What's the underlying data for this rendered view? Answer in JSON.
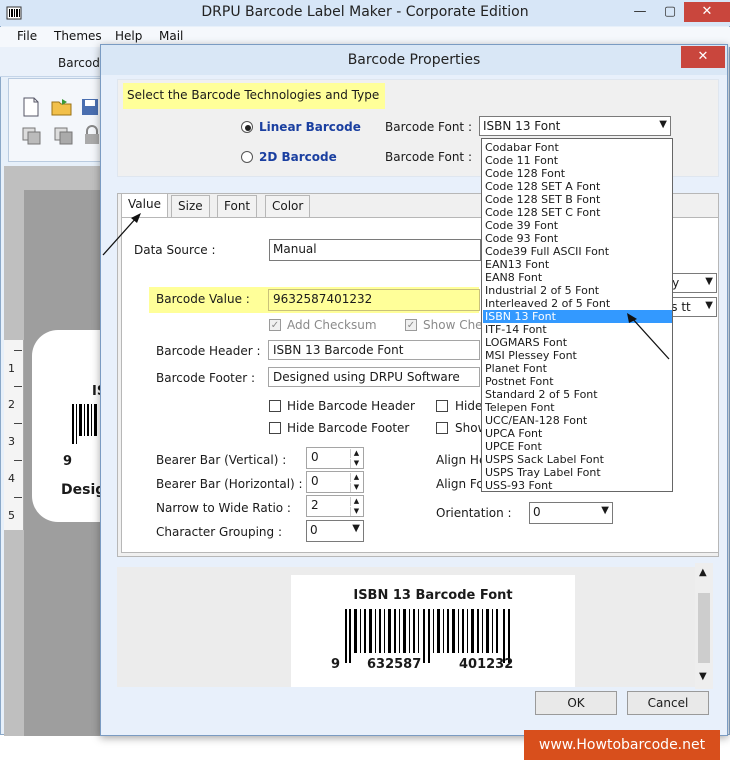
{
  "app": {
    "title": "DRPU Barcode Label Maker - Corporate Edition",
    "menu": [
      "File",
      "Themes",
      "Help",
      "Mail"
    ],
    "ribbon_tab": "Barcode",
    "window_controls": {
      "minimize": "—",
      "maximize": "▢",
      "close": "✕"
    }
  },
  "canvas": {
    "ruler_numbers": [
      "1",
      "2",
      "3",
      "4",
      "5"
    ],
    "label_preview": {
      "line1": "IS",
      "digit": "9",
      "footer": "Desig"
    }
  },
  "dialog": {
    "title": "Barcode Properties",
    "close": "✕",
    "section_title": "Select the Barcode Technologies and Type",
    "radio": {
      "linear": "Linear Barcode",
      "twod": "2D Barcode"
    },
    "barcode_font_label": "Barcode Font :",
    "barcode_font_value": "ISBN 13 Font",
    "barcode_font_label_2": "Barcode Font :",
    "font_options": [
      "Codabar Font",
      "Code 11 Font",
      "Code 128 Font",
      "Code 128 SET A Font",
      "Code 128 SET B Font",
      "Code 128 SET C Font",
      "Code 39 Font",
      "Code 93 Font",
      "Code39 Full ASCII Font",
      "EAN13 Font",
      "EAN8 Font",
      "Industrial 2 of 5 Font",
      "Interleaved 2 of 5 Font",
      "ISBN 13 Font",
      "ITF-14 Font",
      "LOGMARS Font",
      "MSI Plessey Font",
      "Planet Font",
      "Postnet Font",
      "Standard 2 of 5 Font",
      "Telepen Font",
      "UCC/EAN-128 Font",
      "UPCA Font",
      "UPCE Font",
      "USPS Sack Label Font",
      "USPS Tray Label Font",
      "USS-93 Font"
    ],
    "selected_font_index": 13,
    "tabs": [
      "Value",
      "Size",
      "Font",
      "Color"
    ],
    "data_source_label": "Data Source :",
    "data_source_value": "Manual",
    "barcode_value_label": "Barcode Value :",
    "barcode_value": "9632587401232",
    "add_checksum": "Add Checksum",
    "show_chk": "Show Che",
    "header_label": "Barcode Header :",
    "header_value": "ISBN 13 Barcode Font",
    "footer_label": "Barcode Footer :",
    "footer_value": "Designed using DRPU Software",
    "hide_header": "Hide Barcode Header",
    "hide_footer": "Hide Barcode Footer",
    "hide_right1": "Hide",
    "hide_right2": "Show",
    "bearer_v_label": "Bearer Bar (Vertical) :",
    "bearer_v_value": "0",
    "bearer_h_label": "Bearer Bar (Horizontal) :",
    "bearer_h_value": "0",
    "ratio_label": "Narrow to Wide Ratio :",
    "ratio_value": "2",
    "grouping_label": "Character Grouping :",
    "grouping_value": "0",
    "align_header_label": "Align He",
    "align_footer_label": "Align Fo",
    "orientation_label": "Orientation :",
    "orientation_value": "0",
    "right_select_1": "yy",
    "right_select_2": "ss tt",
    "preview": {
      "title": "ISBN 13 Barcode Font",
      "digits_left": "9",
      "digits_mid": "632587",
      "digits_right": "401232"
    },
    "ok": "OK",
    "cancel": "Cancel"
  },
  "watermark": "www.Howtobarcode.net",
  "colors": {
    "highlight": "#ffff99",
    "selection": "#3399ff",
    "close_red": "#c9463d",
    "watermark": "#d84f1c",
    "radio_label": "#1a3fa0"
  }
}
